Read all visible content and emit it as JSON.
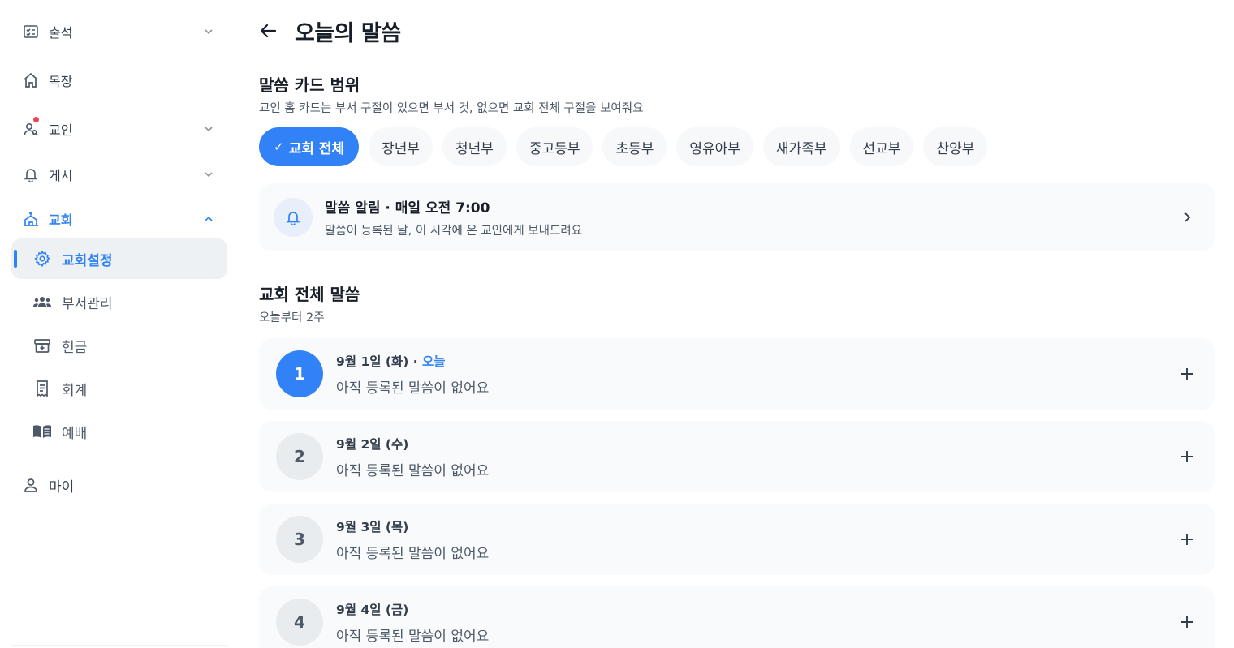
{
  "sidebar": {
    "items": [
      {
        "label": "출석",
        "icon": "checklist-icon",
        "chevron": "down"
      },
      {
        "label": "목장",
        "icon": "home-icon"
      },
      {
        "label": "교인",
        "icon": "members-icon",
        "chevron": "down",
        "badge": true
      },
      {
        "label": "게시",
        "icon": "bell-icon",
        "chevron": "down"
      },
      {
        "label": "교회",
        "icon": "church-icon",
        "chevron": "up",
        "active": true
      }
    ],
    "sub_items": [
      {
        "label": "교회설정",
        "icon": "gear-icon",
        "selected": true
      },
      {
        "label": "부서관리",
        "icon": "group-icon"
      },
      {
        "label": "헌금",
        "icon": "offering-box-icon"
      },
      {
        "label": "회계",
        "icon": "ledger-icon"
      },
      {
        "label": "예배",
        "icon": "book-icon"
      }
    ],
    "my": {
      "label": "마이",
      "icon": "person-icon"
    }
  },
  "header": {
    "title": "오늘의 말씀"
  },
  "scope": {
    "title": "말씀 카드 범위",
    "subtitle": "교인 홈 카드는 부서 구절이 있으면 부서 것, 없으면 교회 전체 구절을 보여줘요",
    "chips": [
      "교회 전체",
      "장년부",
      "청년부",
      "중고등부",
      "초등부",
      "영유아부",
      "새가족부",
      "선교부",
      "찬양부"
    ],
    "selected_chip": "교회 전체"
  },
  "alarm": {
    "title": "말씀 알림 · 매일 오전 7:00",
    "desc": "말씀이 등록된 날, 이 시각에 온 교인에게 보내드려요"
  },
  "list": {
    "title": "교회 전체 말씀",
    "subtitle": "오늘부터 2주",
    "days": [
      {
        "num": "1",
        "date": "9월 1일 (화)",
        "today": "오늘",
        "text": "아직 등록된 말씀이 없어요"
      },
      {
        "num": "2",
        "date": "9월 2일 (수)",
        "text": "아직 등록된 말씀이 없어요"
      },
      {
        "num": "3",
        "date": "9월 3일 (목)",
        "text": "아직 등록된 말씀이 없어요"
      },
      {
        "num": "4",
        "date": "9월 4일 (금)",
        "text": "아직 등록된 말씀이 없어요"
      }
    ]
  },
  "colors": {
    "accent": "#3182f6",
    "badge": "#f04452"
  }
}
